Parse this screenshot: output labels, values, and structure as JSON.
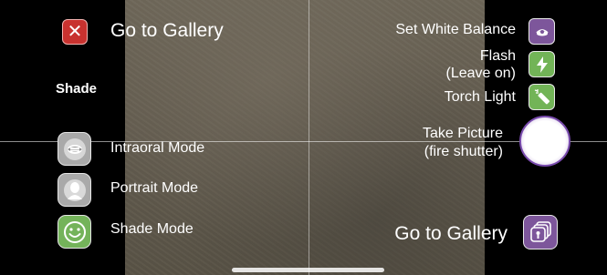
{
  "top": {
    "close_icon": "close-x-icon",
    "gallery_label": "Go to Gallery"
  },
  "shade_label": "Shade",
  "modes": {
    "intraoral": {
      "label": "Intraoral Mode",
      "icon": "mouth-icon"
    },
    "portrait": {
      "label": "Portrait Mode",
      "icon": "person-silhouette-icon"
    },
    "shade": {
      "label": "Shade Mode",
      "icon": "smiley-face-icon"
    }
  },
  "right": {
    "white_balance": {
      "label": "Set White Balance",
      "icon": "white-balance-icon"
    },
    "flash": {
      "label_line1": "Flash",
      "label_line2": "(Leave on)",
      "icon": "flash-icon"
    },
    "torch": {
      "label": "Torch Light",
      "icon": "torch-icon"
    },
    "shutter": {
      "label_line1": "Take Picture",
      "label_line2": "(fire shutter)"
    },
    "gallery": {
      "label": "Go to Gallery",
      "icon": "gallery-stack-icon"
    }
  },
  "colors": {
    "close_red": "#c8322f",
    "accent_purple": "#7d569b",
    "accent_green": "#74b35a",
    "mode_grey": "#a9a9a9"
  }
}
